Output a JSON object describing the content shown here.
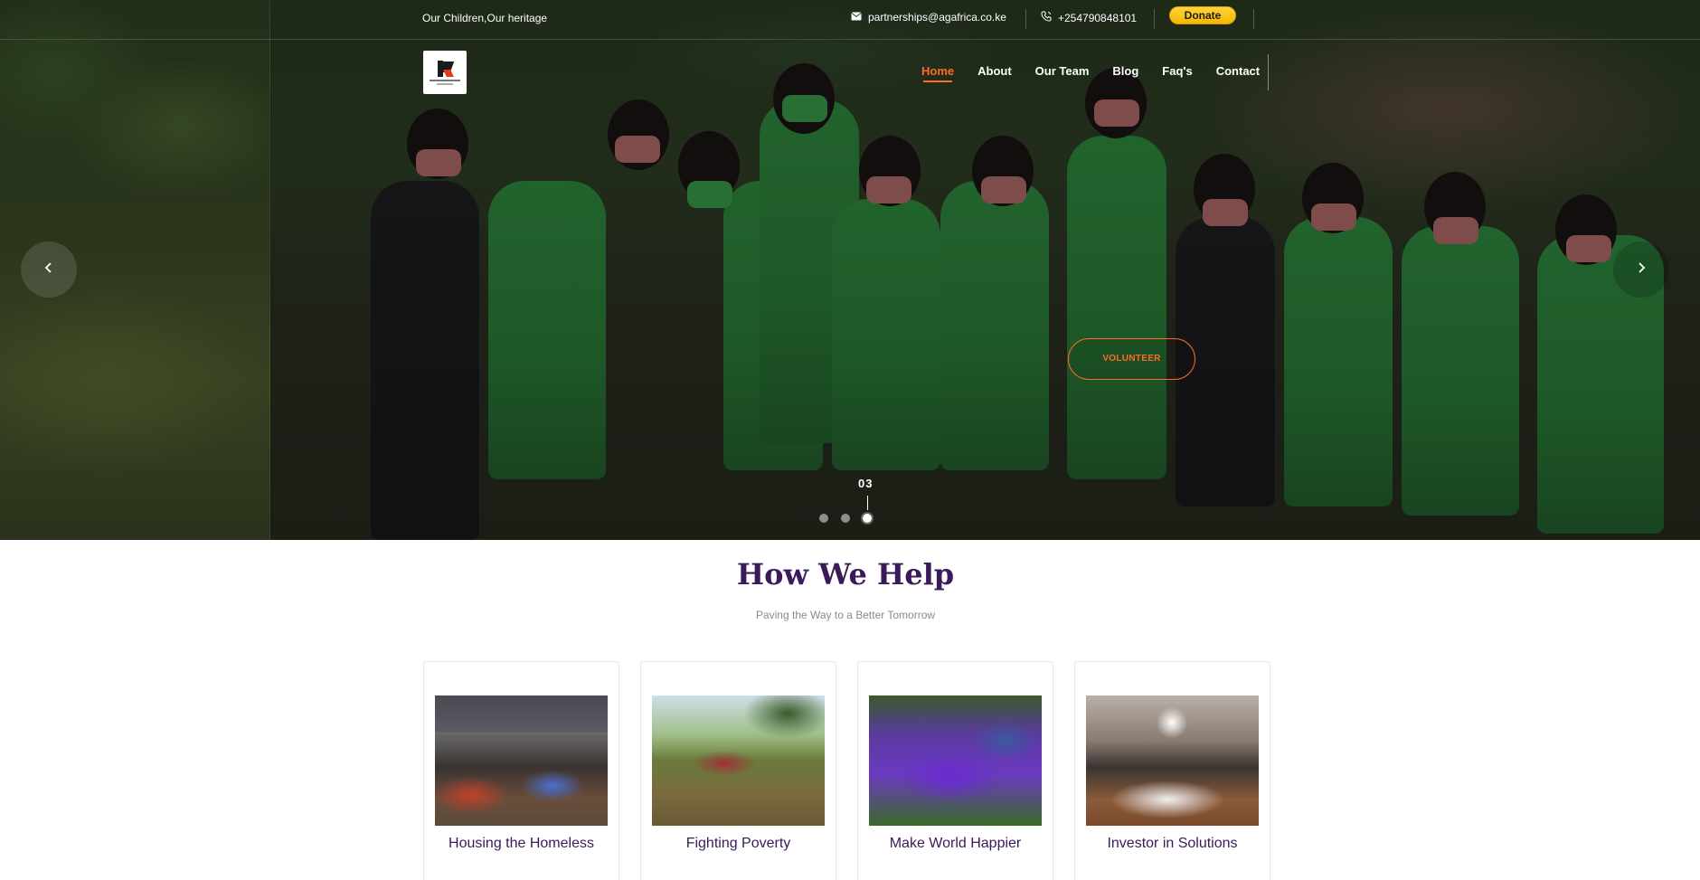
{
  "topbar": {
    "tagline": "Our Children,Our heritage",
    "email": "partnerships@agafrica.co.ke",
    "phone": "+254790848101",
    "donate_label": "Donate"
  },
  "nav": {
    "items": [
      {
        "label": "Home",
        "active": true
      },
      {
        "label": "About",
        "active": false
      },
      {
        "label": "Our Team",
        "active": false
      },
      {
        "label": "Blog",
        "active": false
      },
      {
        "label": "Faq's",
        "active": false
      },
      {
        "label": "Contact",
        "active": false
      }
    ]
  },
  "hero": {
    "volunteer_label": "VOLUNTEER",
    "slide_number": "03",
    "dots": [
      false,
      false,
      true
    ],
    "icons": {
      "prev": "chevron-left-icon",
      "next": "chevron-right-icon"
    }
  },
  "help": {
    "title": "How We Help",
    "subtitle": "Paving the Way to a Better Tomorrow",
    "cards": [
      {
        "title": "Housing the Homeless"
      },
      {
        "title": "Fighting Poverty"
      },
      {
        "title": "Make World Happier"
      },
      {
        "title": "Investor in Solutions"
      }
    ]
  },
  "colors": {
    "accent": "#ff6a28",
    "heading": "#3b1a5a",
    "donate": "#f5b800"
  }
}
